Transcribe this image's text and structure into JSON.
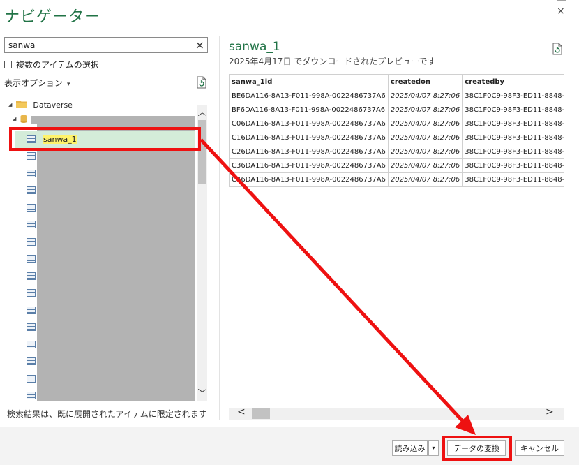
{
  "window": {
    "title": "ナビゲーター",
    "controls": [
      "—",
      "×"
    ]
  },
  "search": {
    "value": "sanwa_",
    "clear_icon": "×"
  },
  "options": {
    "multi_select_label": "複数のアイテムの選択",
    "display_options_label": "表示オプション",
    "display_options_chevron": "▾"
  },
  "tree": {
    "root_label": "Dataverse",
    "root_expand": "◢",
    "db_expand": "◢",
    "selected_item_label": "sanwa_1",
    "scroll_up": "︿",
    "scroll_down": "﹀"
  },
  "footer_note": "検索結果は、既に展開されたアイテムに限定されます",
  "preview": {
    "title": "sanwa_1",
    "subtitle": "2025年4月17日 でダウンロードされたプレビューです",
    "columns": [
      "sanwa_1id",
      "createdon",
      "createdby"
    ],
    "rows": [
      [
        "BE6DA116-8A13-F011-998A-0022486737A6",
        "2025/04/07 8:27:06",
        "38C1F0C9-98F3-ED11-8848-"
      ],
      [
        "BF6DA116-8A13-F011-998A-0022486737A6",
        "2025/04/07 8:27:06",
        "38C1F0C9-98F3-ED11-8848-"
      ],
      [
        "C06DA116-8A13-F011-998A-0022486737A6",
        "2025/04/07 8:27:06",
        "38C1F0C9-98F3-ED11-8848-"
      ],
      [
        "C16DA116-8A13-F011-998A-0022486737A6",
        "2025/04/07 8:27:06",
        "38C1F0C9-98F3-ED11-8848-"
      ],
      [
        "C26DA116-8A13-F011-998A-0022486737A6",
        "2025/04/07 8:27:06",
        "38C1F0C9-98F3-ED11-8848-"
      ],
      [
        "C36DA116-8A13-F011-998A-0022486737A6",
        "2025/04/07 8:27:06",
        "38C1F0C9-98F3-ED11-8848-"
      ],
      [
        "C46DA116-8A13-F011-998A-0022486737A6",
        "2025/04/07 8:27:06",
        "38C1F0C9-98F3-ED11-8848-"
      ]
    ],
    "hscroll_left": "<",
    "hscroll_right": ">"
  },
  "buttons": {
    "load": "読み込み",
    "load_dropdown": "▾",
    "transform": "データの変換",
    "cancel": "キャンセル"
  },
  "colors": {
    "accent_green": "#217346",
    "selected_row_bg": "#d4ecd9",
    "search_highlight": "#fff36b",
    "annotation_red": "#ee1111",
    "redacted_gray": "#b3b3b3"
  },
  "icons": {
    "refresh": "refresh-icon",
    "folder": "folder-icon",
    "database": "database-icon",
    "table": "table-icon"
  }
}
